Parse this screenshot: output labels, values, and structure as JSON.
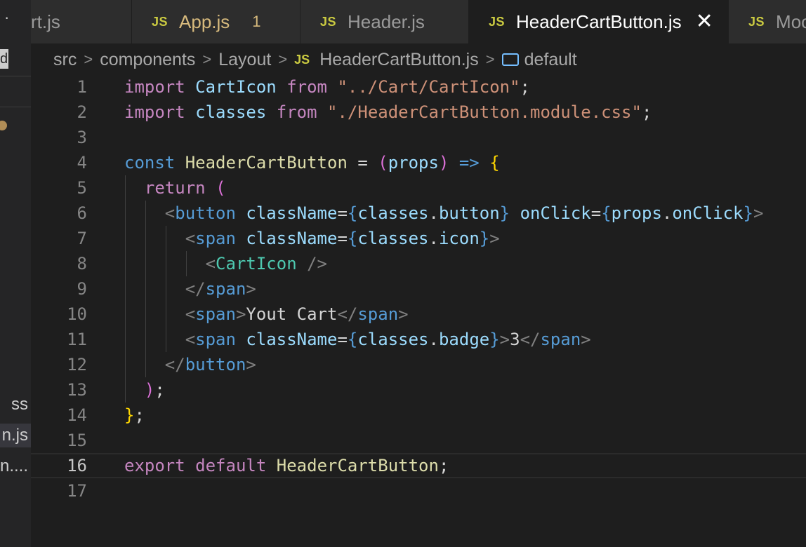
{
  "sidebar": {
    "dots": "·",
    "badge": "d",
    "files": [
      "ss",
      "n.js",
      "n...."
    ]
  },
  "tabs": [
    {
      "label": "rt.js",
      "icon": "",
      "count": ""
    },
    {
      "label": "App.js",
      "icon": "JS",
      "count": "1"
    },
    {
      "label": "Header.js",
      "icon": "JS",
      "count": ""
    },
    {
      "label": "HeaderCartButton.js",
      "icon": "JS",
      "count": ""
    },
    {
      "label": "Moc",
      "icon": "JS",
      "count": ""
    }
  ],
  "close_glyph": "✕",
  "breadcrumb": {
    "parts": [
      "src",
      "components",
      "Layout"
    ],
    "file": "HeaderCartButton.js",
    "symbol": "default",
    "js_icon": "JS",
    "sep": ">"
  },
  "editor": {
    "current_line": 16,
    "lines": [
      [
        [
          "t-kw",
          "import"
        ],
        [
          "t-plain",
          " "
        ],
        [
          "t-var",
          "CartIcon"
        ],
        [
          "t-plain",
          " "
        ],
        [
          "t-kw",
          "from"
        ],
        [
          "t-plain",
          " "
        ],
        [
          "t-str",
          "\"../Cart/CartIcon\""
        ],
        [
          "t-plain",
          ";"
        ]
      ],
      [
        [
          "t-kw",
          "import"
        ],
        [
          "t-plain",
          " "
        ],
        [
          "t-var",
          "classes"
        ],
        [
          "t-plain",
          " "
        ],
        [
          "t-kw",
          "from"
        ],
        [
          "t-plain",
          " "
        ],
        [
          "t-str",
          "\"./HeaderCartButton.module.css\""
        ],
        [
          "t-plain",
          ";"
        ]
      ],
      [],
      [
        [
          "t-storage",
          "const"
        ],
        [
          "t-plain",
          " "
        ],
        [
          "t-fn",
          "HeaderCartButton"
        ],
        [
          "t-plain",
          " = "
        ],
        [
          "t-b2",
          "("
        ],
        [
          "t-var",
          "props"
        ],
        [
          "t-b2",
          ")"
        ],
        [
          "t-plain",
          " "
        ],
        [
          "t-storage",
          "=>"
        ],
        [
          "t-plain",
          " "
        ],
        [
          "t-b1",
          "{"
        ]
      ],
      [
        [
          "t-plain",
          "  "
        ],
        [
          "t-kw",
          "return"
        ],
        [
          "t-plain",
          " "
        ],
        [
          "t-b2",
          "("
        ]
      ],
      [
        [
          "t-plain",
          "    "
        ],
        [
          "t-tagpunct",
          "<"
        ],
        [
          "t-tag",
          "button"
        ],
        [
          "t-plain",
          " "
        ],
        [
          "t-attr",
          "className"
        ],
        [
          "t-plain",
          "="
        ],
        [
          "t-brace",
          "{"
        ],
        [
          "t-var",
          "classes"
        ],
        [
          "t-plain",
          "."
        ],
        [
          "t-var",
          "button"
        ],
        [
          "t-brace",
          "}"
        ],
        [
          "t-plain",
          " "
        ],
        [
          "t-attr",
          "onClick"
        ],
        [
          "t-plain",
          "="
        ],
        [
          "t-brace",
          "{"
        ],
        [
          "t-var",
          "props"
        ],
        [
          "t-plain",
          "."
        ],
        [
          "t-var",
          "onClick"
        ],
        [
          "t-brace",
          "}"
        ],
        [
          "t-tagpunct",
          ">"
        ]
      ],
      [
        [
          "t-plain",
          "      "
        ],
        [
          "t-tagpunct",
          "<"
        ],
        [
          "t-tag",
          "span"
        ],
        [
          "t-plain",
          " "
        ],
        [
          "t-attr",
          "className"
        ],
        [
          "t-plain",
          "="
        ],
        [
          "t-brace",
          "{"
        ],
        [
          "t-var",
          "classes"
        ],
        [
          "t-plain",
          "."
        ],
        [
          "t-var",
          "icon"
        ],
        [
          "t-brace",
          "}"
        ],
        [
          "t-tagpunct",
          ">"
        ]
      ],
      [
        [
          "t-plain",
          "        "
        ],
        [
          "t-tagpunct",
          "<"
        ],
        [
          "t-comp",
          "CartIcon"
        ],
        [
          "t-plain",
          " "
        ],
        [
          "t-tagpunct",
          "/>"
        ]
      ],
      [
        [
          "t-plain",
          "      "
        ],
        [
          "t-tagpunct",
          "</"
        ],
        [
          "t-tag",
          "span"
        ],
        [
          "t-tagpunct",
          ">"
        ]
      ],
      [
        [
          "t-plain",
          "      "
        ],
        [
          "t-tagpunct",
          "<"
        ],
        [
          "t-tag",
          "span"
        ],
        [
          "t-tagpunct",
          ">"
        ],
        [
          "t-plain",
          "Yout Cart"
        ],
        [
          "t-tagpunct",
          "</"
        ],
        [
          "t-tag",
          "span"
        ],
        [
          "t-tagpunct",
          ">"
        ]
      ],
      [
        [
          "t-plain",
          "      "
        ],
        [
          "t-tagpunct",
          "<"
        ],
        [
          "t-tag",
          "span"
        ],
        [
          "t-plain",
          " "
        ],
        [
          "t-attr",
          "className"
        ],
        [
          "t-plain",
          "="
        ],
        [
          "t-brace",
          "{"
        ],
        [
          "t-var",
          "classes"
        ],
        [
          "t-plain",
          "."
        ],
        [
          "t-var",
          "badge"
        ],
        [
          "t-brace",
          "}"
        ],
        [
          "t-tagpunct",
          ">"
        ],
        [
          "t-plain",
          "3"
        ],
        [
          "t-tagpunct",
          "</"
        ],
        [
          "t-tag",
          "span"
        ],
        [
          "t-tagpunct",
          ">"
        ]
      ],
      [
        [
          "t-plain",
          "    "
        ],
        [
          "t-tagpunct",
          "</"
        ],
        [
          "t-tag",
          "button"
        ],
        [
          "t-tagpunct",
          ">"
        ]
      ],
      [
        [
          "t-plain",
          "  "
        ],
        [
          "t-b2",
          ")"
        ],
        [
          "t-plain",
          ";"
        ]
      ],
      [
        [
          "t-b1",
          "}"
        ],
        [
          "t-plain",
          ";"
        ]
      ],
      [],
      [
        [
          "t-kw",
          "export"
        ],
        [
          "t-plain",
          " "
        ],
        [
          "t-kw",
          "default"
        ],
        [
          "t-plain",
          " "
        ],
        [
          "t-fn",
          "HeaderCartButton"
        ],
        [
          "t-plain",
          ";"
        ]
      ],
      []
    ]
  }
}
